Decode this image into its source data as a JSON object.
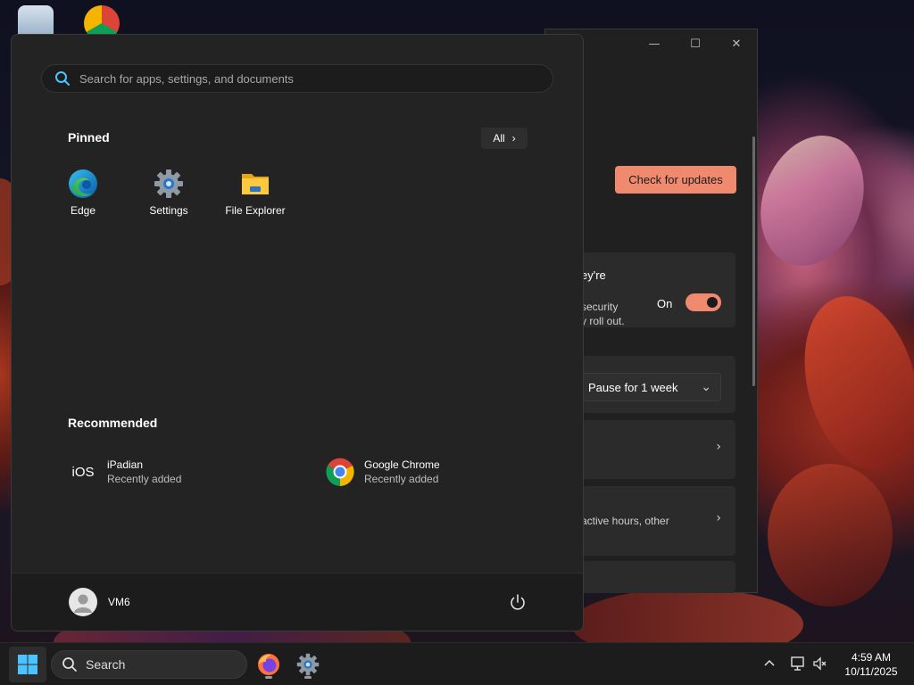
{
  "start_menu": {
    "search_placeholder": "Search for apps, settings, and documents",
    "pinned_title": "Pinned",
    "all_label": "All",
    "pinned_apps": [
      {
        "label": "Edge",
        "icon": "edge-icon"
      },
      {
        "label": "Settings",
        "icon": "settings-gear-icon"
      },
      {
        "label": "File Explorer",
        "icon": "folder-icon"
      }
    ],
    "recommended_title": "Recommended",
    "recommended": [
      {
        "name": "iPadian",
        "subtitle": "Recently added",
        "icon_text": "iOS"
      },
      {
        "name": "Google Chrome",
        "subtitle": "Recently added",
        "icon": "chrome-icon"
      }
    ],
    "user_name": "VM6"
  },
  "settings_window": {
    "check_updates": "Check for updates",
    "partial_heading": "ey're",
    "partial_line1": "security",
    "partial_line2": "y roll out.",
    "toggle_label": "On",
    "pause_label": "Pause for 1 week",
    "partial_active": "active hours, other",
    "minimize": "—",
    "maximize": "☐",
    "close": "✕"
  },
  "taskbar": {
    "search_label": "Search",
    "time": "4:59 AM",
    "date": "10/11/2025"
  },
  "colors": {
    "accent": "#f08a6f",
    "menu_bg": "#232323",
    "taskbar_bg": "#1c1c1c"
  }
}
